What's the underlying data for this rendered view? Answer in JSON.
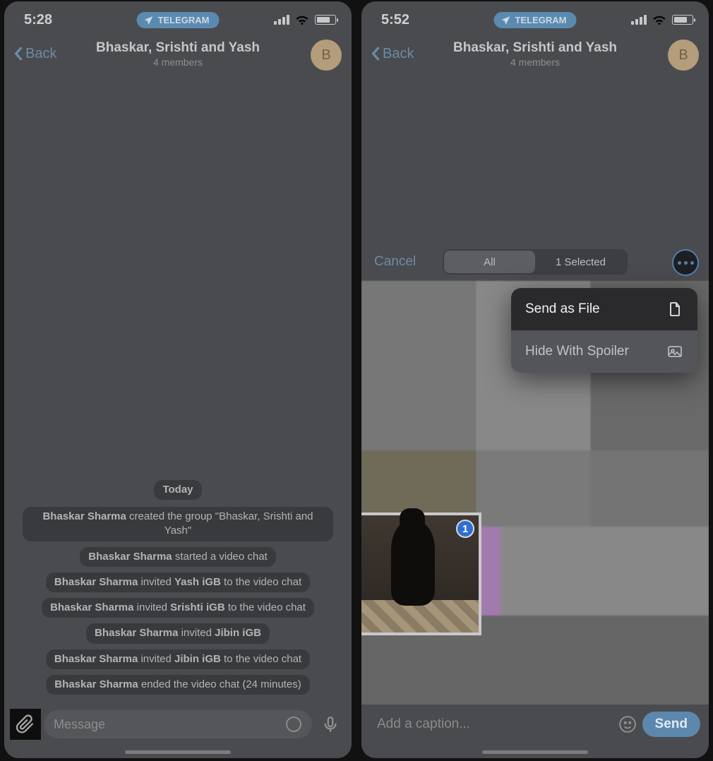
{
  "left": {
    "status_time": "5:28",
    "pill_label": "TELEGRAM",
    "back_label": "Back",
    "chat_title": "Bhaskar, Srishti and Yash",
    "chat_subtitle": "4 members",
    "avatar_initial": "B",
    "day_label": "Today",
    "sys": [
      {
        "a": "Bhaskar Sharma",
        "t": "created the group \"Bhaskar, Srishti and Yash\""
      },
      {
        "a": "Bhaskar Sharma",
        "t": "started a video chat"
      },
      {
        "a": "Bhaskar Sharma",
        "t": "invited",
        "b": "Yash iGB",
        "s": "to the video chat"
      },
      {
        "a": "Bhaskar Sharma",
        "t": "invited",
        "b": "Srishti iGB",
        "s": "to the video chat"
      },
      {
        "a": "Bhaskar Sharma",
        "t": "invited",
        "b": "Jibin iGB"
      },
      {
        "a": "Bhaskar Sharma",
        "t": "invited",
        "b": "Jibin iGB",
        "s": "to the video chat"
      },
      {
        "a": "Bhaskar Sharma",
        "t": "ended the video chat (24 minutes)"
      }
    ],
    "msg_placeholder": "Message"
  },
  "right": {
    "status_time": "5:52",
    "pill_label": "TELEGRAM",
    "back_label": "Back",
    "chat_title": "Bhaskar, Srishti and Yash",
    "chat_subtitle": "4 members",
    "avatar_initial": "B",
    "cancel_label": "Cancel",
    "seg_all": "All",
    "seg_selected": "1 Selected",
    "selected_badge": "1",
    "ctx_send_as_file": "Send as File",
    "ctx_hide_spoiler": "Hide With Spoiler",
    "caption_placeholder": "Add a caption...",
    "send_label": "Send"
  }
}
